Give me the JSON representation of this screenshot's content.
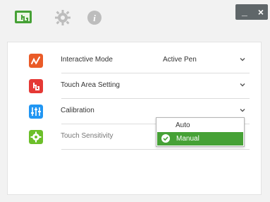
{
  "toolbar": {
    "touch_icon": "touch-hand-icon",
    "settings_icon": "gear-icon",
    "info_icon": "info-icon"
  },
  "window_controls": {
    "minimize": "_",
    "close": "×"
  },
  "colors": {
    "interactive": "#ea5b28",
    "touch_area": "#e53935",
    "calibration": "#2196f3",
    "sensitivity": "#6cbf2a",
    "selected": "#46a136"
  },
  "settings": {
    "interactive_mode": {
      "label": "Interactive Mode",
      "value": "Active Pen",
      "icon": "pen-icon"
    },
    "touch_area": {
      "label": "Touch Area Setting",
      "value": "",
      "icon": "touch-area-icon"
    },
    "calibration": {
      "label": "Calibration",
      "value": "",
      "icon": "sliders-icon"
    },
    "sensitivity": {
      "label": "Touch Sensitivity",
      "value": "",
      "icon": "sensitivity-gear-icon"
    }
  },
  "calibration_dropdown": {
    "options": [
      "Auto",
      "Manual"
    ],
    "selected": "Manual"
  }
}
